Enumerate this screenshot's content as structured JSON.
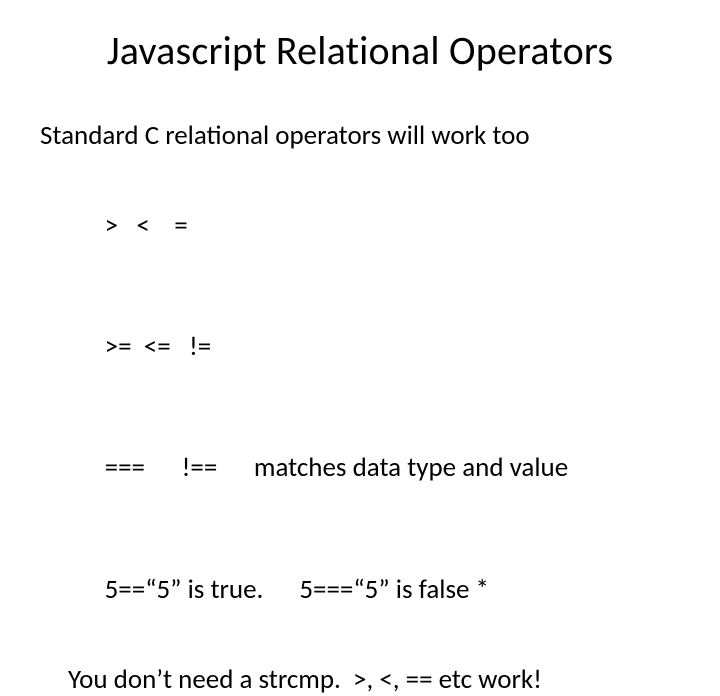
{
  "title": "Javascript Relational Operators",
  "intro": "Standard C relational operators will work too",
  "row1_a": ">",
  "row1_b": "<",
  "row1_c": "=",
  "row2_a": ">=",
  "row2_b": "<=",
  "row2_c": "!=",
  "row3_a": "===",
  "row3_b": "!==",
  "row3_note": "matches data type and value",
  "ex_true": "5==“5”  is true.",
  "ex_false": "5===“5”  is false *",
  "strcmp": "You don’t need a strcmp.  >, <, == etc work!"
}
